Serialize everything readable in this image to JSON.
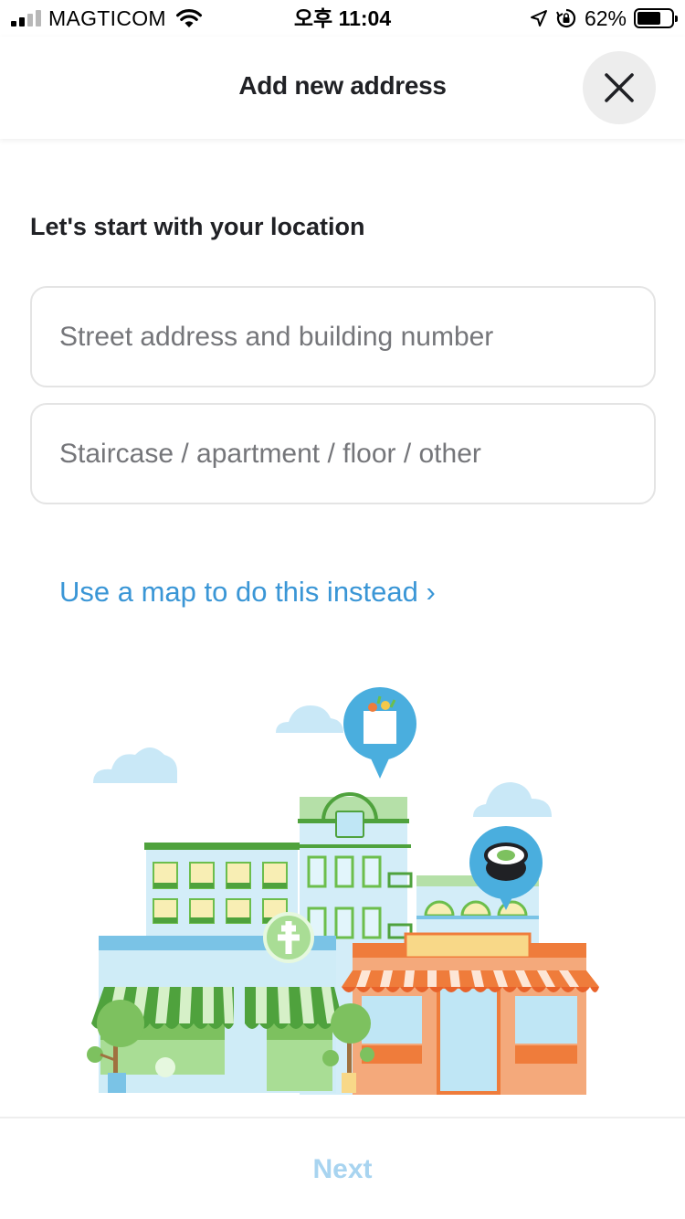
{
  "status_bar": {
    "carrier": "MAGTICOM",
    "time": "오후 11:04",
    "battery_percent": "62%",
    "battery_level": 0.62,
    "icons": [
      "signal-icon",
      "wifi-icon",
      "location-arrow-icon",
      "rotation-lock-icon",
      "battery-icon"
    ]
  },
  "header": {
    "title": "Add new address",
    "close_icon": "close-icon"
  },
  "form": {
    "section_title": "Let's start with your location",
    "street_placeholder": "Street address and building number",
    "street_value": "",
    "details_placeholder": "Staircase / apartment / floor / other",
    "details_value": ""
  },
  "map_link": "Use a map to do this instead ›",
  "illustration": {
    "icons": [
      "cloud-icon",
      "grocery-bag-pin-icon",
      "sushi-pin-icon",
      "pharmacy-cross-icon",
      "storefront-illustration"
    ]
  },
  "footer": {
    "next_label": "Next"
  },
  "colors": {
    "accent": "#3a96d6",
    "next_disabled": "#a8d4f0",
    "text_primary": "#202125",
    "placeholder": "#75767a",
    "input_border": "#e4e4e4",
    "close_bg": "#ededed"
  }
}
